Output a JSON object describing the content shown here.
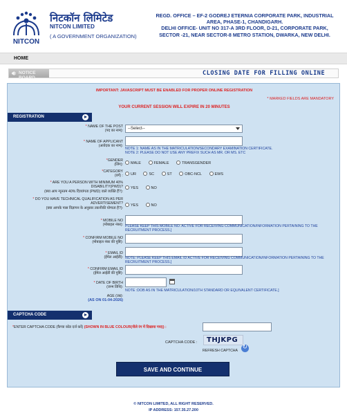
{
  "header": {
    "logo_icon": "nitcon-logo-icon",
    "logo_caption": "NITCON",
    "org_name_hindi": "निटकॉन लिमिटेड",
    "org_name": "NITCON LIMITED",
    "org_tagline": "( A GOVERNMENT ORGANIZATION)",
    "office_lines": [
      "REGD. OFFICE – EF-2 GODREJ ETERNIA CORPORATE PARK, INDUSTRIAL",
      "AREA, PHASE-1, CHANDIGARH.",
      "DELHI OFFICE- UNIT NO 317-A 3RD FLOOR, D-21, CORPORATE PARK,",
      "SECTOR -21, NEAR SECTOR-8 METRO STATION, DWARKA, NEW DELHI."
    ]
  },
  "nav": {
    "home": "HOME"
  },
  "notice": {
    "tab_label": "NOTICE BOARD",
    "marquee": "CLOSING DATE FOR FILLING ONLINE"
  },
  "messages": {
    "important": "IMPORTANT: JAVASCRIPT MUST BE ENABLED FOR PROPER ONLINE REGISTRATION",
    "mandatory": "* MARKED FIELDS ARE MANDATORY",
    "session": "YOUR CURRENT SESSION WILL EXPIRE IN 20 MINUTES"
  },
  "registration": {
    "section_title": "REGISTRATION",
    "post": {
      "label": "NAME OF THE POST",
      "label_hindi": "(पद का नाम):",
      "selected": "--Select--"
    },
    "applicant": {
      "label": "NAME OF APPLICANT",
      "label_hindi": "(आवेदक का नाम):",
      "note1": "NOTE 1: NAME AS IN THE MATRICULATION/SECONDARY EXAMINATION CERTIFICATE.",
      "note2": "NOTE 2: PLEASE DO NOT USE ANY PREFIX SUCH AS MR. OR MS. ETC"
    },
    "gender": {
      "label": "GENDER",
      "label_hindi": "(लिंग):",
      "options": [
        "MALE",
        "FEMALE",
        "TRANSGENDER"
      ]
    },
    "category": {
      "label": "CATEGORY",
      "label_hindi": "(वर्ग) :",
      "options": [
        "UR",
        "SC",
        "ST",
        "OBC-NCL",
        "EWS"
      ]
    },
    "pwd": {
      "label_line1": "ARE YOU A PERSON WITH MINIMUM 40%",
      "label_line2": "DISABILITY(PWD)?",
      "label_hindi": "(क्या आप न्यूनतम 40% दिव्यांगता (PWD) वाले व्यक्ति हैं?):",
      "options": [
        "YES",
        "NO"
      ]
    },
    "qualification": {
      "label_line1": "DO YOU HAVE TECHNICAL QUALIFICATION AS PER",
      "label_line2": "ADVERTISEMENT?",
      "label_hindi": "(क्या आपके पास विज्ञापन के अनुसार तकनीकी योग्यता है?):",
      "options": [
        "YES",
        "NO"
      ]
    },
    "mobile": {
      "label": "MOBILE NO",
      "label_hindi": "(मोबाइल नंबर):",
      "note": "PLEASE KEEP THIS MOBILE NO. ACTIVE FOR RECEIVING COMMUNICATION/INFORMATION PERTAINING TO THE",
      "note2": "RECRUITMENT PROCESS.]"
    },
    "confirm_mobile": {
      "label": "CONFIRM MOBILE NO",
      "label_hindi": "(मोबाइल नंबर की पुष्टि):"
    },
    "email": {
      "label": "EMAIL ID",
      "label_hindi": "(ईमेल आईडी):",
      "note": "NOTE: PLEASE KEEP THIS EMAIL ID ACTIVE FOR RECEIVING COMMUNICATION/INFORMATION PERTAINING TO THE",
      "note2": "RECRUITMENT PROCESS.]"
    },
    "confirm_email": {
      "label": "CONFIRM EMAIL ID",
      "label_hindi": "(ईमेल आईडी की पुष्टि):"
    },
    "dob": {
      "label": "DATE OF BIRTH",
      "label_hindi": "(जन्म तिथि):",
      "note": "NOTE :DOB AS IN THE MATRICULATION/10TH STANDARD OR EQUIVALENT CERTIFICATE.]"
    },
    "age": {
      "label": "AGE (उम्र):",
      "value": "(AS ON 01-04-2026)"
    }
  },
  "captcha": {
    "section_title": "CAPTCHA CODE",
    "enter_label": "ENTER CAPTCHA CODE (कैप्चा कोड दर्ज करें)",
    "shown_blue": "(SHOWN IN BLUE COLOUR(नीले रंग में दिखाया गया)) :",
    "code_label": "CAPTCHA CODE :",
    "code": "THJKPG",
    "refresh_label": "REFRESH CAPTCHA"
  },
  "submit_label": "SAVE AND CONTINUE",
  "footer": {
    "copyright": "© NITCON LIMITED, ALL RIGHT RESERVED.",
    "ip": "IP ADDRESS: 157.35.27.200"
  },
  "colors": {
    "brand_navy": "#14306e",
    "panel_bg": "#cfe2f2",
    "warning_red": "#dd2222",
    "link_blue": "#1c3f9b"
  }
}
